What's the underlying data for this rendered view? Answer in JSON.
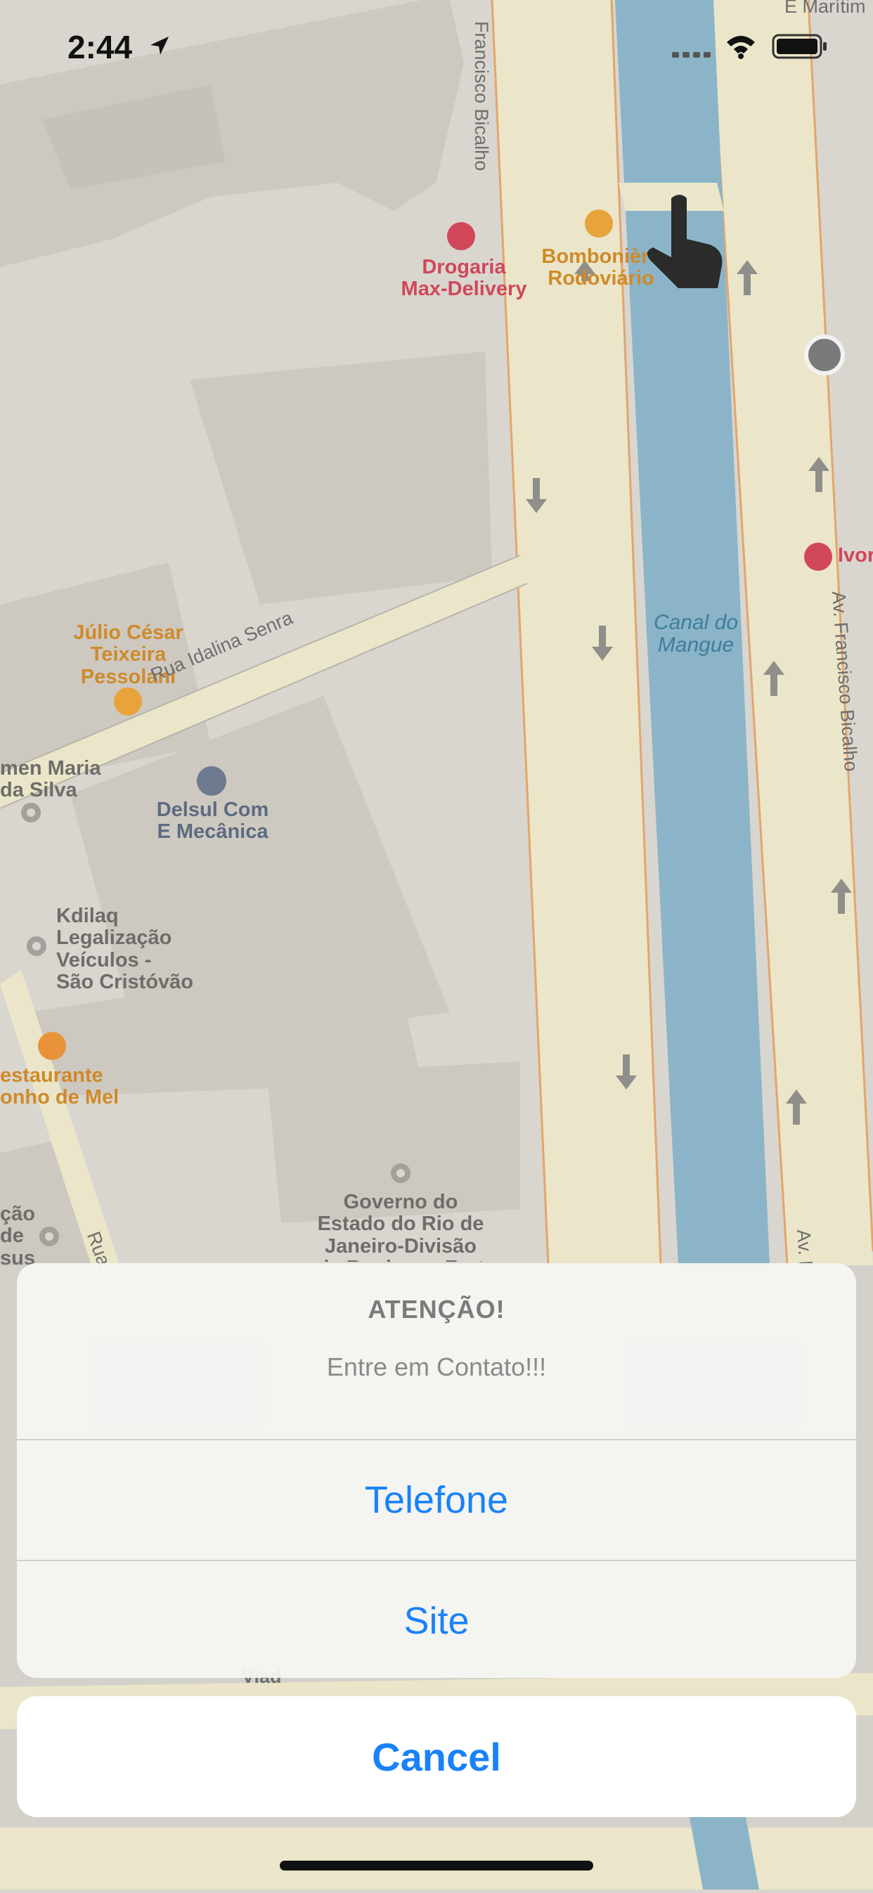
{
  "status_bar": {
    "time": "2:44",
    "location_icon": "location-arrow-icon",
    "signal_icon": "cellular-signal-icon",
    "wifi_icon": "wifi-icon",
    "battery_icon": "battery-icon"
  },
  "map": {
    "pois": [
      {
        "name": "Drogaria\nMax-Delivery",
        "icon": "pharmacy-icon",
        "color": "#d0475a"
      },
      {
        "name": "Bombonière\nRodoviário",
        "icon": "basket-icon",
        "color": "#cf8a2a"
      },
      {
        "name": "Júlio César\nTeixeira\nPessolani",
        "icon": "briefcase-icon",
        "color": "#cf8a2a"
      },
      {
        "name": "Delsul Com\nE Mecânica",
        "icon": "car-icon",
        "color": "#5d6b80"
      },
      {
        "name": "Kdilaq\nLegalização\nVeículos -\nSão Cristóvão",
        "icon": "pin-icon",
        "color": "#6e6d6a"
      },
      {
        "name": "estaurante\nonho de Mel",
        "icon": "fork-knife-icon",
        "color": "#cf8a2a"
      },
      {
        "name": "Governo do\nEstado do Rio de\nJaneiro-Divisão\nde Roubos e Furt",
        "icon": "pin-icon",
        "color": "#6e6d6a"
      },
      {
        "name": "men Maria\nda Silva",
        "icon": "pin-icon",
        "color": "#6e6d6a"
      },
      {
        "name": "ção\nde\nsus",
        "icon": "pin-icon",
        "color": "#6e6d6a"
      },
      {
        "name": "Ivor",
        "icon": "stethoscope-icon",
        "color": "#d0475a"
      }
    ],
    "streets": {
      "idalina": "Rua Idalina Senra",
      "bicalho_top": "Francisco Bicalho",
      "bicalho_right": "Av. Francisco Bicalho",
      "maritima": "E Marítim",
      "av_l": "Av. I",
      "rua_l": "Rua",
      "viad": "Viad"
    },
    "water": "Canal do\nMangue",
    "colors": {
      "land": "#d9d6cf",
      "building": "#cdc9c1",
      "road": "#ebe6c9",
      "road_edge": "#e2a56d",
      "water": "#8bb4c8"
    }
  },
  "action_sheet": {
    "title": "ATENÇÃO!",
    "message": "Entre em Contato!!!",
    "options": [
      "Telefone",
      "Site"
    ],
    "cancel": "Cancel"
  }
}
